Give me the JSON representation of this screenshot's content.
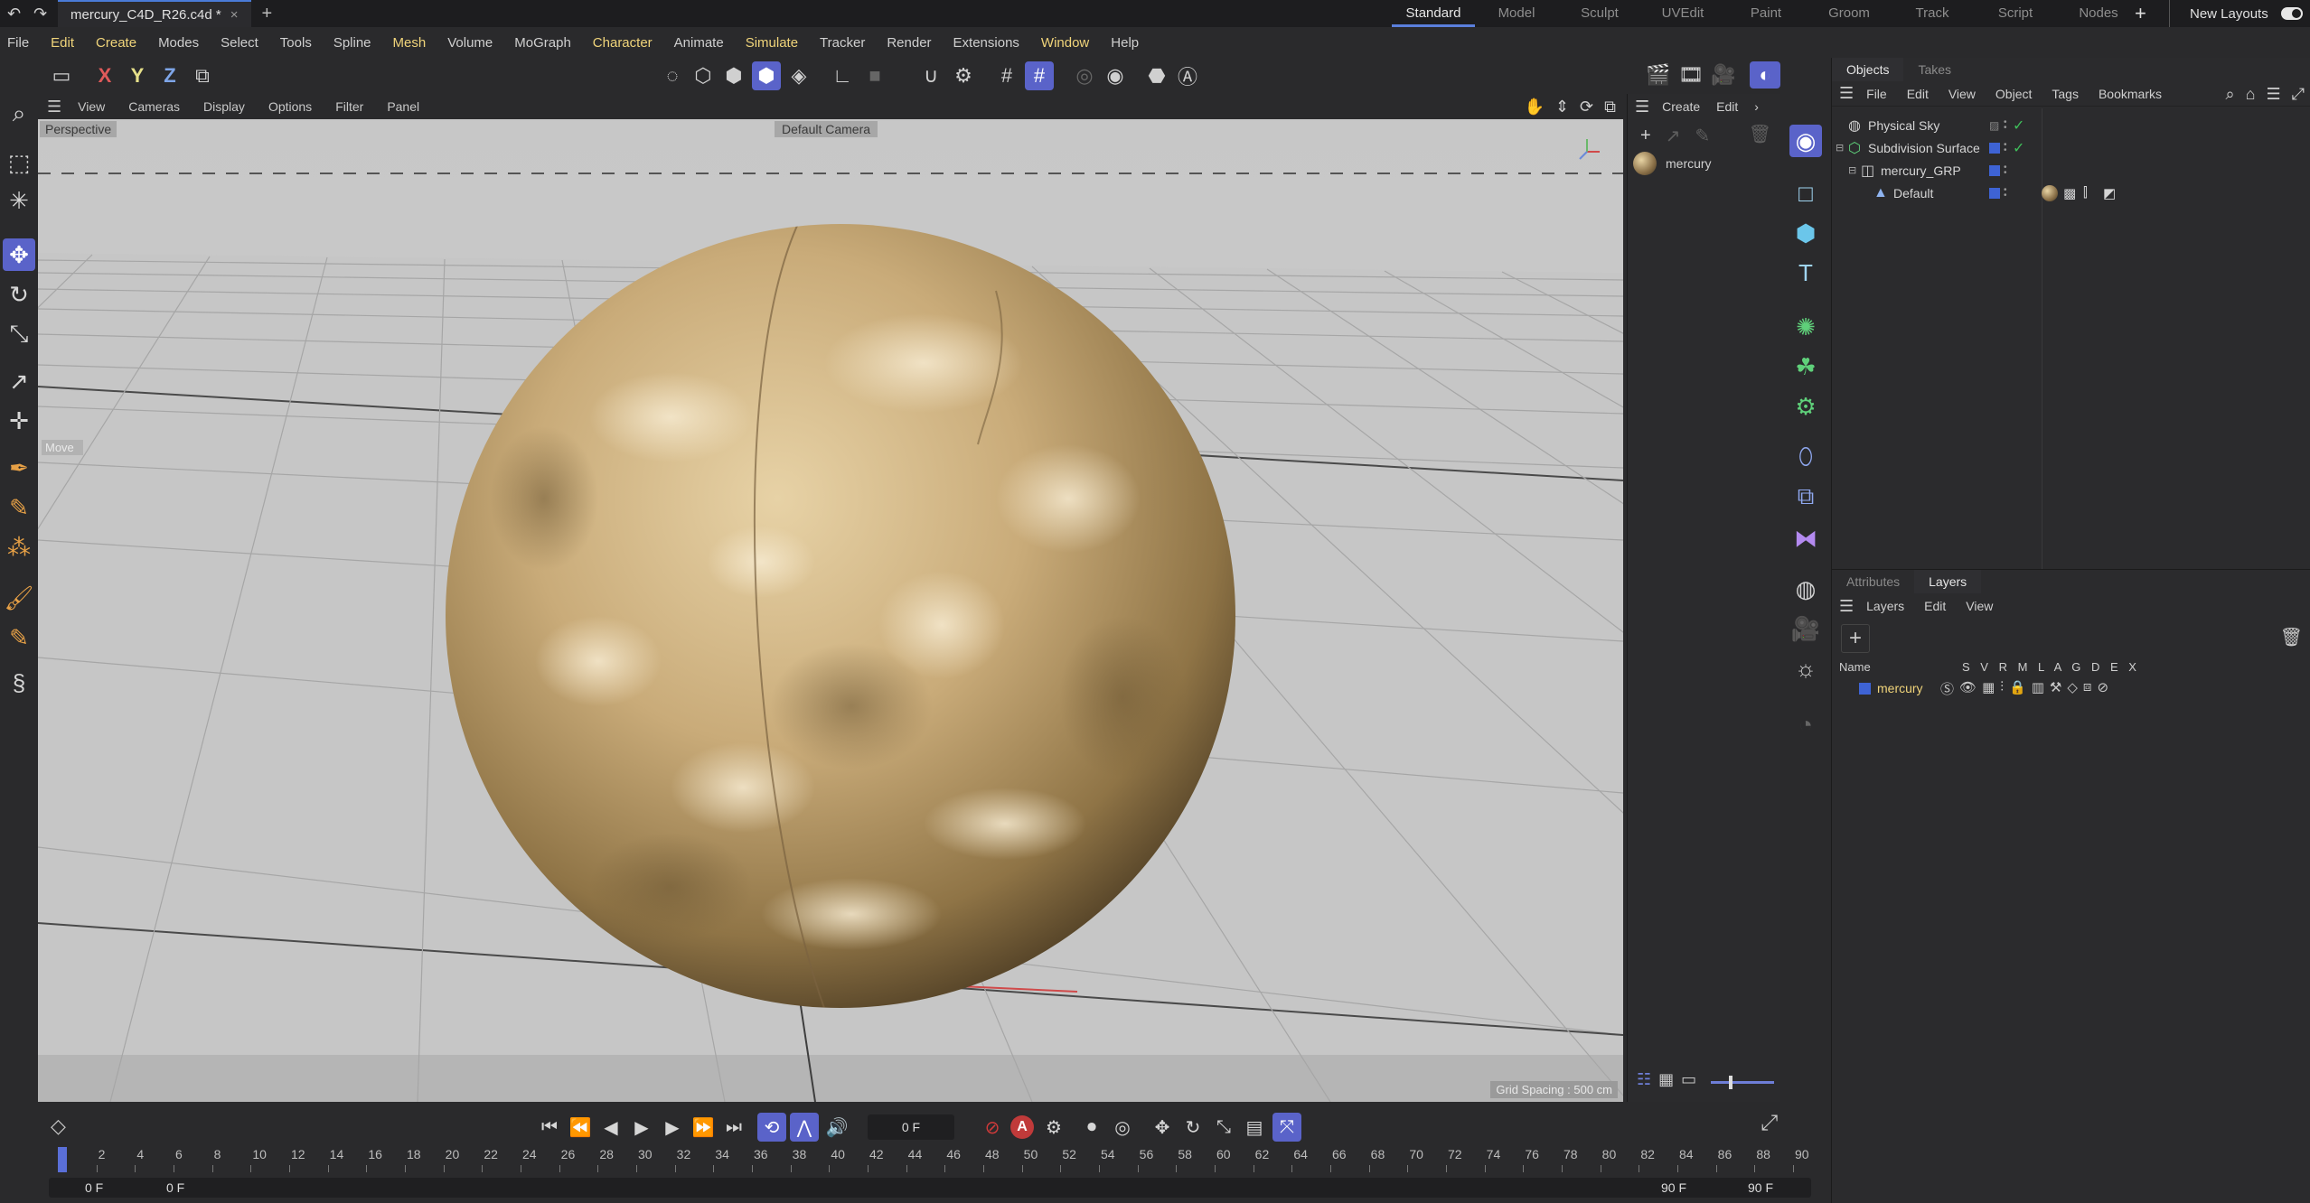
{
  "titlebar": {
    "doc_tab": "mercury_C4D_R26.c4d *",
    "layouts": [
      "Standard",
      "Model",
      "Sculpt",
      "UVEdit",
      "Paint",
      "Groom",
      "Track",
      "Script",
      "Nodes"
    ],
    "new_layouts": "New Layouts"
  },
  "menubar": {
    "items": [
      "File",
      "Edit",
      "Create",
      "Modes",
      "Select",
      "Tools",
      "Spline",
      "Mesh",
      "Volume",
      "MoGraph",
      "Character",
      "Animate",
      "Simulate",
      "Tracker",
      "Render",
      "Extensions",
      "Window",
      "Help"
    ]
  },
  "toolbar": {
    "axis_x": "X",
    "axis_y": "Y",
    "axis_z": "Z"
  },
  "viewport": {
    "menu": [
      "View",
      "Cameras",
      "Display",
      "Options",
      "Filter",
      "Panel"
    ],
    "view_name": "Perspective",
    "camera": "Default Camera",
    "tool_hint": "Move",
    "grid_spacing": "Grid Spacing : 500 cm"
  },
  "material_manager": {
    "menu": [
      "Create",
      "Edit"
    ],
    "material_name": "mercury"
  },
  "objects_panel": {
    "tabs": [
      "Objects",
      "Takes"
    ],
    "menu": [
      "File",
      "Edit",
      "View",
      "Object",
      "Tags",
      "Bookmarks"
    ],
    "rows": [
      {
        "name": "Physical Sky"
      },
      {
        "name": "Subdivision Surface"
      },
      {
        "name": "mercury_GRP"
      },
      {
        "name": "Default"
      }
    ],
    "layer_color": "#3e63d4",
    "check_color": "#3fbf5a"
  },
  "layers_panel": {
    "tabs": [
      "Attributes",
      "Layers"
    ],
    "menu": [
      "Layers",
      "Edit",
      "View"
    ],
    "header_name": "Name",
    "header_cols": "S V R M L A G D E X",
    "layer": {
      "name": "mercury",
      "color": "#3e63d4"
    }
  },
  "timeline": {
    "current_frame": "0 F",
    "ticks": [
      "0",
      "2",
      "4",
      "6",
      "8",
      "10",
      "12",
      "14",
      "16",
      "18",
      "20",
      "22",
      "24",
      "26",
      "28",
      "30",
      "32",
      "34",
      "36",
      "38",
      "40",
      "42",
      "44",
      "46",
      "48",
      "50",
      "52",
      "54",
      "56",
      "58",
      "60",
      "62",
      "64",
      "66",
      "68",
      "70",
      "72",
      "74",
      "76",
      "78",
      "80",
      "82",
      "84",
      "86",
      "88",
      "90"
    ],
    "range_start": "0 F",
    "range_start2": "0 F",
    "range_end": "90 F",
    "range_end2": "90 F"
  },
  "colors": {
    "accent": "#5a63c9",
    "highlight_menu": "#f0d47a",
    "sphere": "#c8aa78"
  }
}
